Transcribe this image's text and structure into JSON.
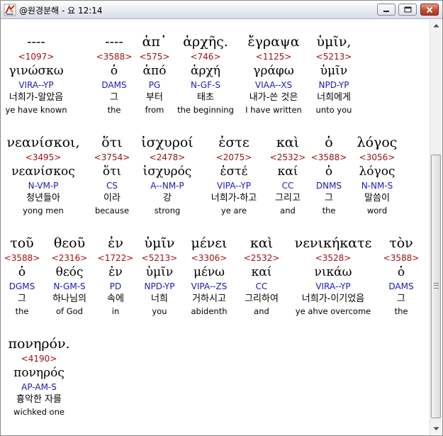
{
  "window": {
    "title": "@원경분해 - 요 12:14"
  },
  "icons": {
    "app": "app-logo-icon",
    "minimize": "minimize-icon",
    "maximize": "maximize-icon",
    "close": "close-icon",
    "scroll_up": "scroll-up-arrow-icon",
    "scroll_down": "scroll-down-arrow-icon"
  },
  "colors": {
    "strongs": "#a01010",
    "parsing": "#1a1ab4",
    "text": "#000000"
  },
  "rows": [
    {
      "words": [
        {
          "greek": "----",
          "strongs": "<1097>",
          "lemma": "γινώσκω",
          "parse": "VIRA--YP",
          "korean": "너희가-알았음",
          "english": "ye have known"
        },
        {
          "greek": "----",
          "strongs": "<3588>",
          "lemma": "ὁ",
          "parse": "DAMS",
          "korean": "그",
          "english": "the"
        },
        {
          "greek": "ἀπ᾽",
          "strongs": "<575>",
          "lemma": "ἀπό",
          "parse": "PG",
          "korean": "부터",
          "english": "from"
        },
        {
          "greek": "ἀρχῆς.",
          "strongs": "<746>",
          "lemma": "ἀρχή",
          "parse": "N-GF-S",
          "korean": "태초",
          "english": "the beginning"
        },
        {
          "greek": "ἔγραψα",
          "strongs": "<1125>",
          "lemma": "γράφω",
          "parse": "VIAA--XS",
          "korean": "내가-쓴 것은",
          "english": "I have written"
        },
        {
          "greek": "ὑμῖν,",
          "strongs": "<5213>",
          "lemma": "ὑμῖν",
          "parse": "NPD-YP",
          "korean": "너희에게",
          "english": "unto you"
        }
      ]
    },
    {
      "words": [
        {
          "greek": "νεανίσκοι,",
          "strongs": "<3495>",
          "lemma": "νεανίσκος",
          "parse": "N-VM-P",
          "korean": "청년들아",
          "english": "yong men"
        },
        {
          "greek": "ὅτι",
          "strongs": "<3754>",
          "lemma": "ὅτι",
          "parse": "CS",
          "korean": "이라",
          "english": "because"
        },
        {
          "greek": "ἰσχυροί",
          "strongs": "<2478>",
          "lemma": "ἰσχυρός",
          "parse": "A--NM-P",
          "korean": "강",
          "english": "strong"
        },
        {
          "greek": "ἐστε",
          "strongs": "<2075>",
          "lemma": "ἐστέ",
          "parse": "VIPA--YP",
          "korean": "너희가-하고",
          "english": "ye are"
        },
        {
          "greek": "καὶ",
          "strongs": "<2532>",
          "lemma": "καί",
          "parse": "CC",
          "korean": "그리고",
          "english": "and"
        },
        {
          "greek": "ὁ",
          "strongs": "<3588>",
          "lemma": "ὁ",
          "parse": "DNMS",
          "korean": "그",
          "english": "the"
        },
        {
          "greek": "λόγος",
          "strongs": "<3056>",
          "lemma": "λόγος",
          "parse": "N-NM-S",
          "korean": "말씀이",
          "english": "word"
        }
      ]
    },
    {
      "words": [
        {
          "greek": "τοῦ",
          "strongs": "<3588>",
          "lemma": "ὁ",
          "parse": "DGMS",
          "korean": "그",
          "english": "the"
        },
        {
          "greek": "θεοῦ",
          "strongs": "<2316>",
          "lemma": "θεός",
          "parse": "N-GM-S",
          "korean": "하나님의",
          "english": "of God"
        },
        {
          "greek": "ἐν",
          "strongs": "<1722>",
          "lemma": "ἐν",
          "parse": "PD",
          "korean": "속에",
          "english": "in"
        },
        {
          "greek": "ὑμῖν",
          "strongs": "<5213>",
          "lemma": "ὑμῖν",
          "parse": "NPD-YP",
          "korean": "너희",
          "english": "you"
        },
        {
          "greek": "μένει",
          "strongs": "<3306>",
          "lemma": "μένω",
          "parse": "VIPA--ZS",
          "korean": "거하시고",
          "english": "abidenth"
        },
        {
          "greek": "καὶ",
          "strongs": "<2532>",
          "lemma": "καί",
          "parse": "CC",
          "korean": "그리하여",
          "english": "and"
        },
        {
          "greek": "νενικήκατε",
          "strongs": "<3528>",
          "lemma": "νικάω",
          "parse": "VIRA--YP",
          "korean": "너희가-이기었음",
          "english": "ye ahve overcome"
        },
        {
          "greek": "τὸν",
          "strongs": "<3588>",
          "lemma": "ὁ",
          "parse": "DAMS",
          "korean": "그",
          "english": "the"
        }
      ]
    },
    {
      "words": [
        {
          "greek": "πονηρόν.",
          "strongs": "<4190>",
          "lemma": "πονηρός",
          "parse": "AP-AM-S",
          "korean": "흉악한 자를",
          "english": "wichked one"
        }
      ]
    }
  ]
}
